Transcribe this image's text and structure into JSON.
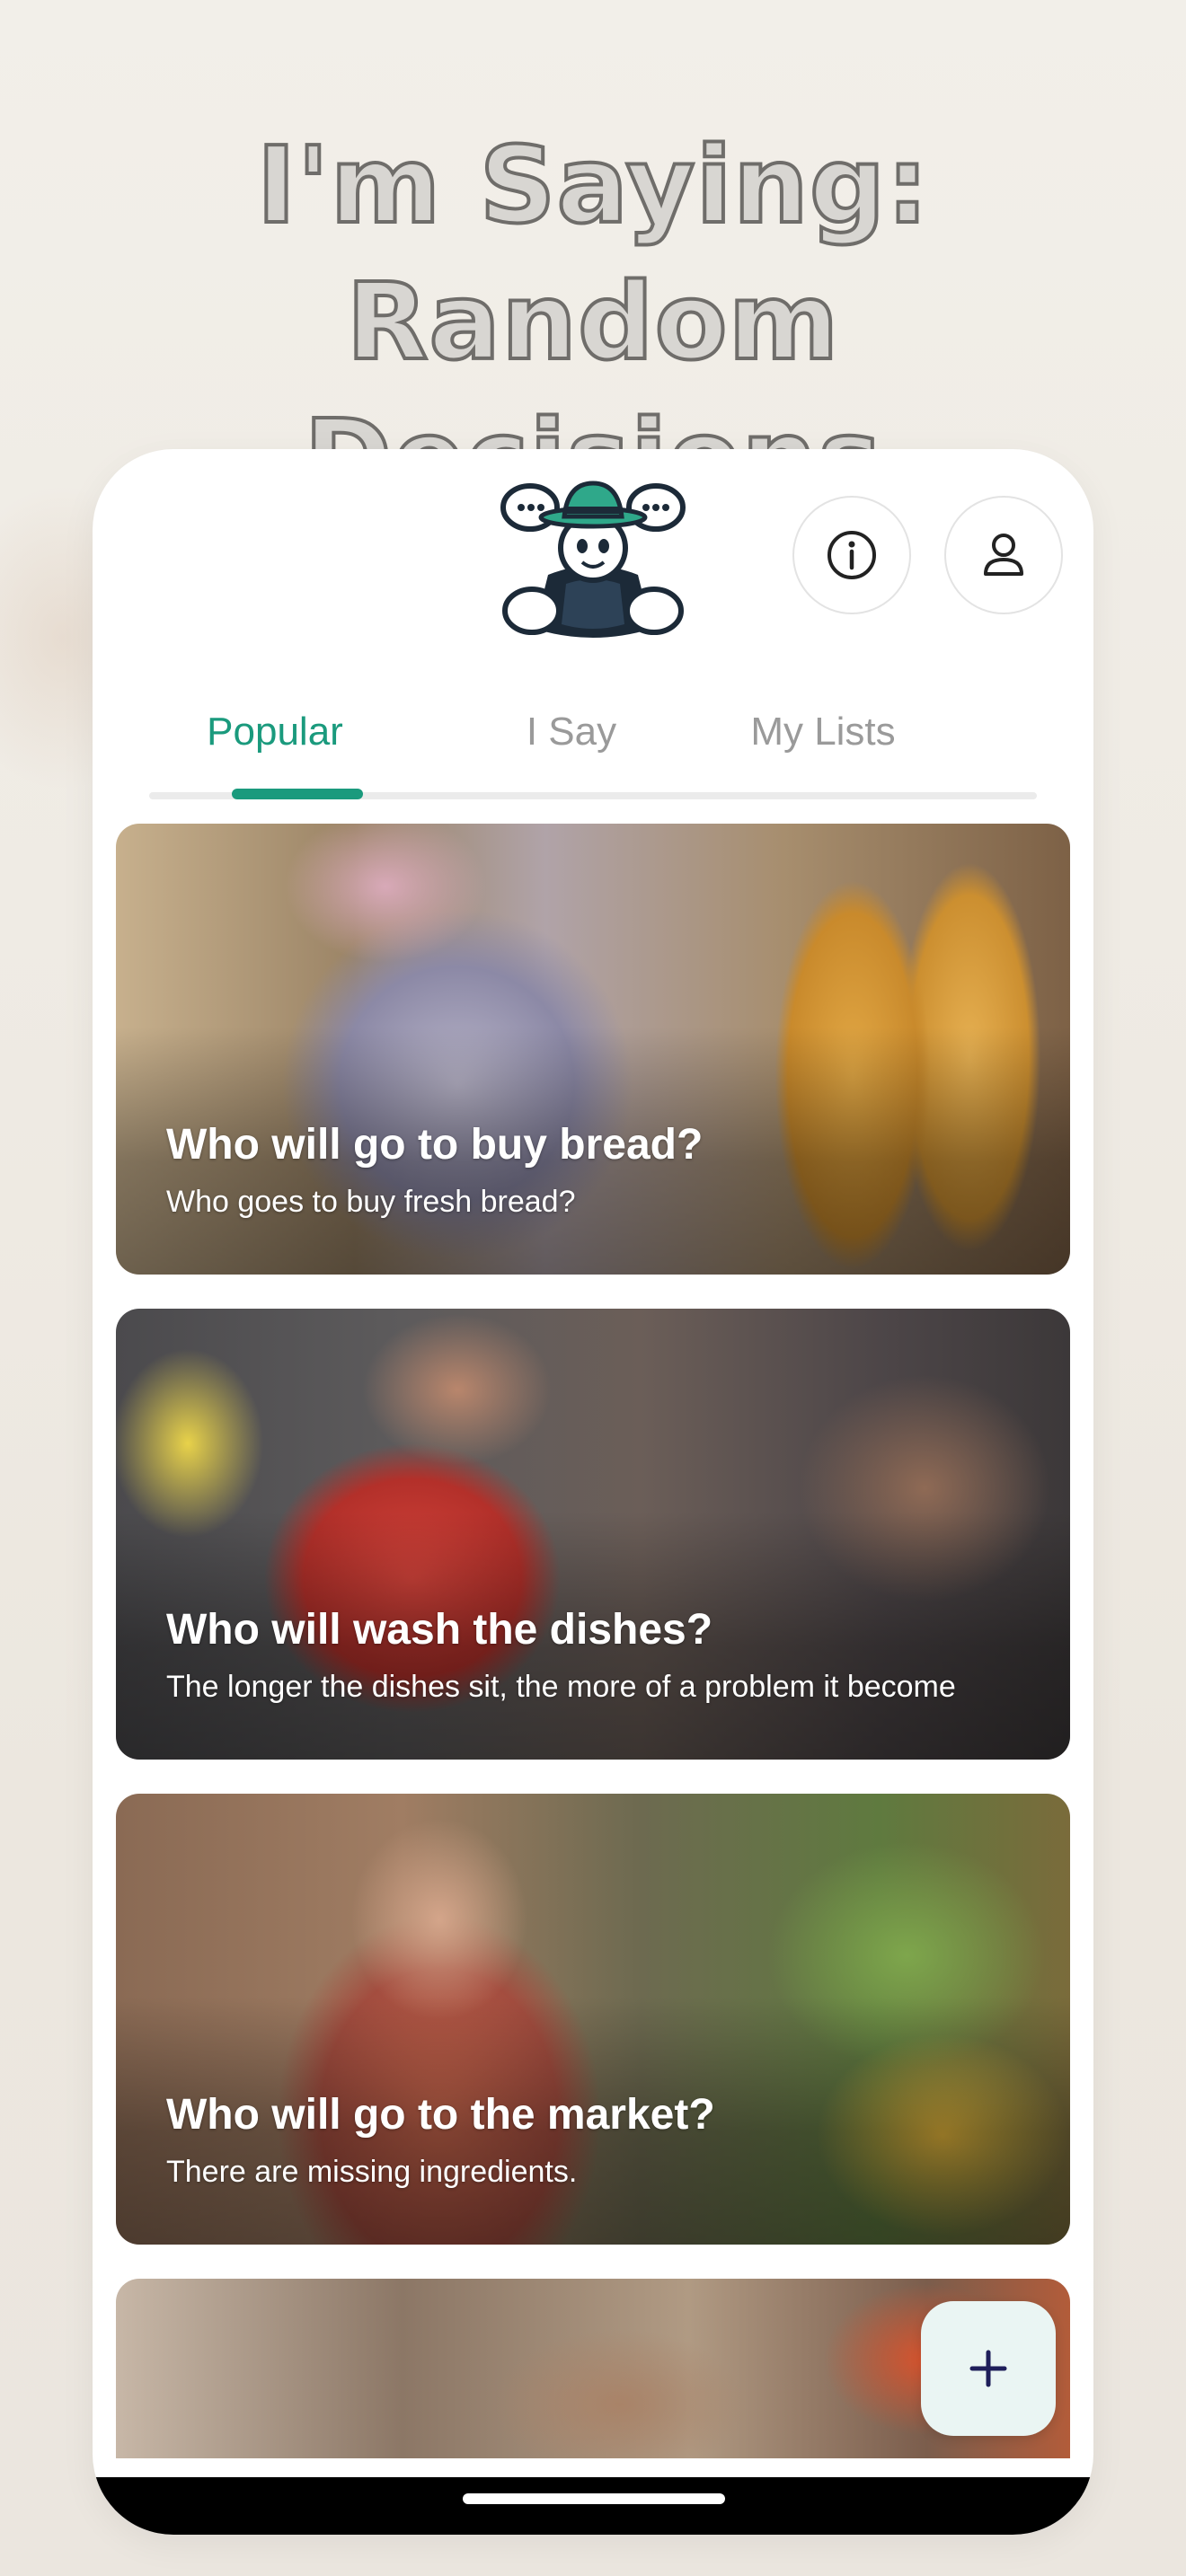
{
  "headline": {
    "line1": "I'm Saying: Random",
    "line2": "Decisions"
  },
  "header": {
    "logo_icon": "cowboy-mascot-logo",
    "info_icon": "info-icon",
    "profile_icon": "user-icon"
  },
  "tabs": [
    {
      "label": "Popular",
      "active": true
    },
    {
      "label": "I Say",
      "active": false
    },
    {
      "label": "My Lists",
      "active": false
    }
  ],
  "cards": [
    {
      "title": "Who will go to buy bread?",
      "subtitle": "Who goes to buy fresh bread?"
    },
    {
      "title": "Who will wash the dishes?",
      "subtitle": "The longer the dishes sit, the more of a problem it become"
    },
    {
      "title": "Who will go to the market?",
      "subtitle": "There are missing ingredients."
    },
    {
      "title": "",
      "subtitle": ""
    }
  ],
  "fab": {
    "icon": "plus-icon"
  },
  "colors": {
    "accent": "#1a9a7d",
    "tab_inactive": "#9a9a9a",
    "fab_bg": "#eaf5f3"
  }
}
